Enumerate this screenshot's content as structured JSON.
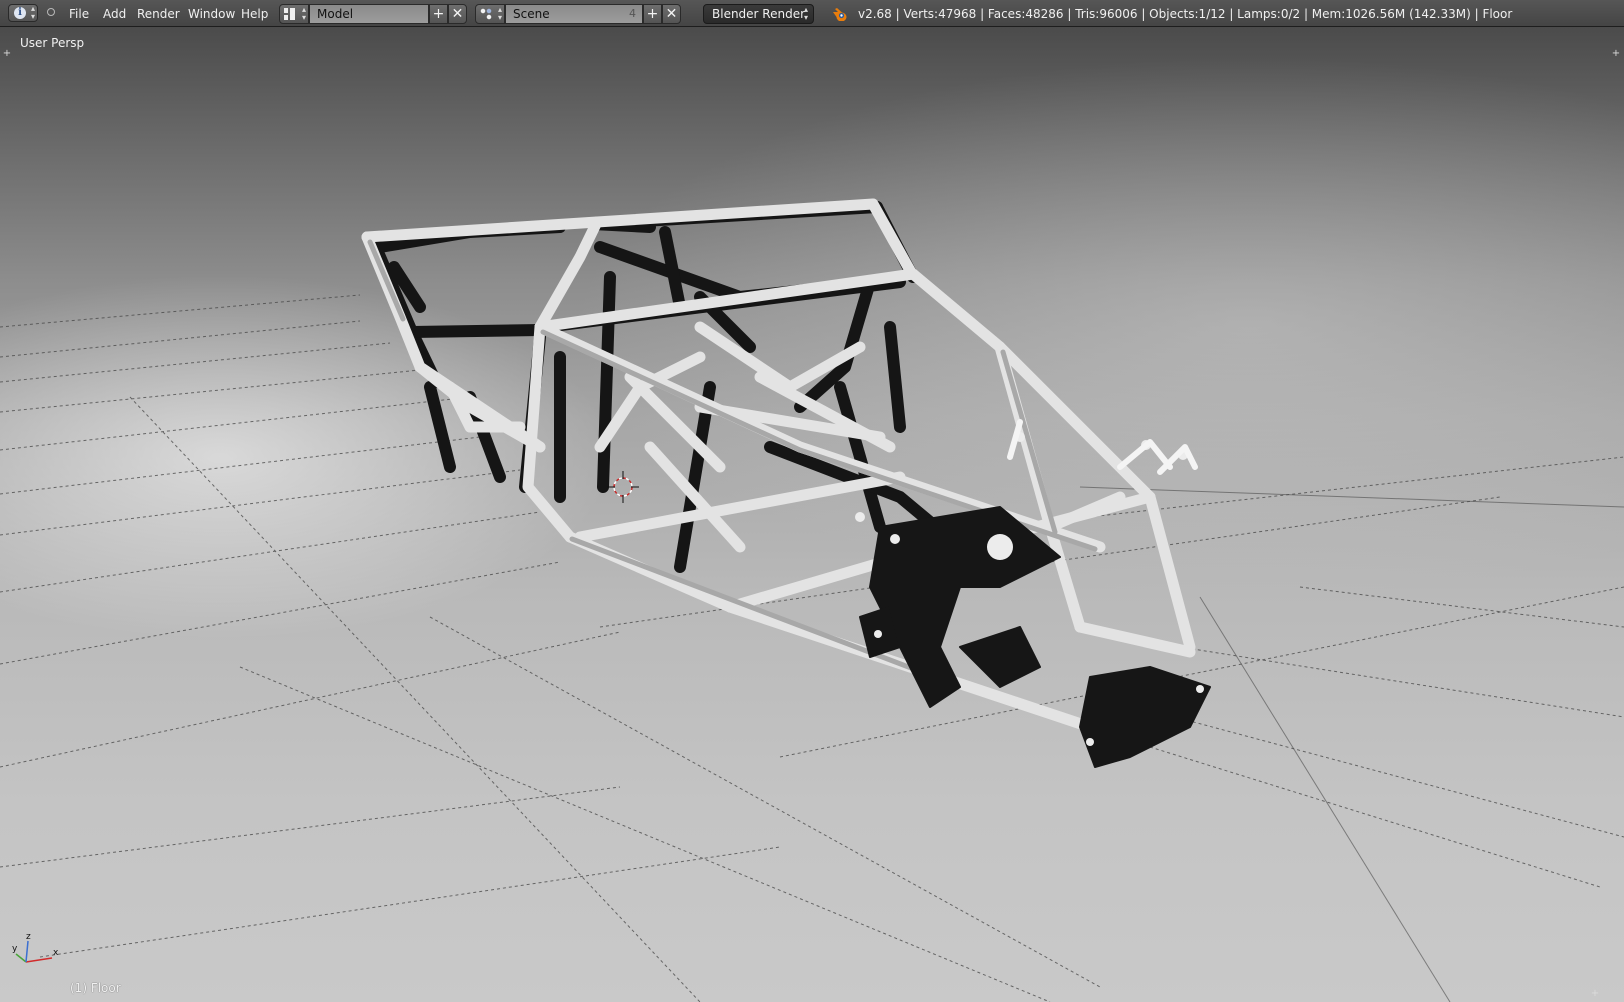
{
  "header": {
    "menus": [
      "File",
      "Add",
      "Render",
      "Window",
      "Help"
    ],
    "screen_layout": "Model",
    "scene": {
      "name": "Scene",
      "users": "4"
    },
    "render_engine": "Blender Render",
    "stats": "v2.68 | Verts:47968 | Faces:48286 | Tris:96006 | Objects:1/12 | Lamps:0/2 | Mem:1026.56M (142.33M) | Floor"
  },
  "viewport": {
    "view_name": "User Persp",
    "active_object": "(1) Floor",
    "axes": {
      "x": "x",
      "y": "y",
      "z": "z"
    }
  },
  "colors": {
    "header_bg": "#4f4f4f",
    "field_bg": "#939393",
    "engine_bg": "#2f2f2f",
    "axis_x": "#d12b2b",
    "axis_y": "#4aa53a",
    "axis_z": "#3b6fd1",
    "cursor_red": "#c82a2a"
  }
}
